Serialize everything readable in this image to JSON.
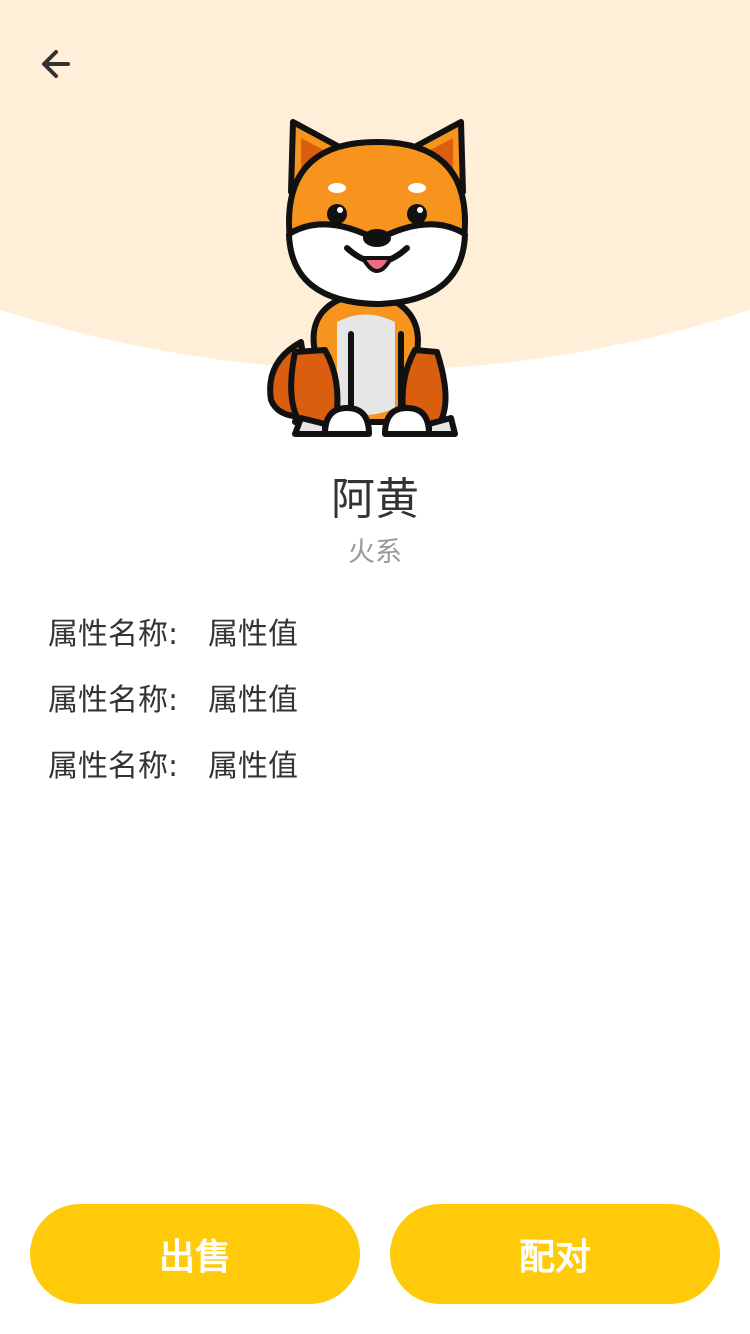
{
  "colors": {
    "hero_background": "#FFEFD8",
    "button_background": "#FFCA0A",
    "button_text": "#FFFFFF",
    "primary_text": "#333333",
    "secondary_text": "#999999",
    "pet_orange": "#F7941E",
    "pet_dark_orange": "#D95F0E"
  },
  "header": {
    "back_icon": "arrow-left-icon"
  },
  "pet": {
    "image_icon": "shiba-dog-illustration",
    "name": "阿黄",
    "type": "火系"
  },
  "attributes": [
    {
      "key": "属性名称:",
      "value": "属性值"
    },
    {
      "key": "属性名称:",
      "value": "属性值"
    },
    {
      "key": "属性名称:",
      "value": "属性值"
    }
  ],
  "actions": {
    "sell_label": "出售",
    "pair_label": "配对"
  }
}
